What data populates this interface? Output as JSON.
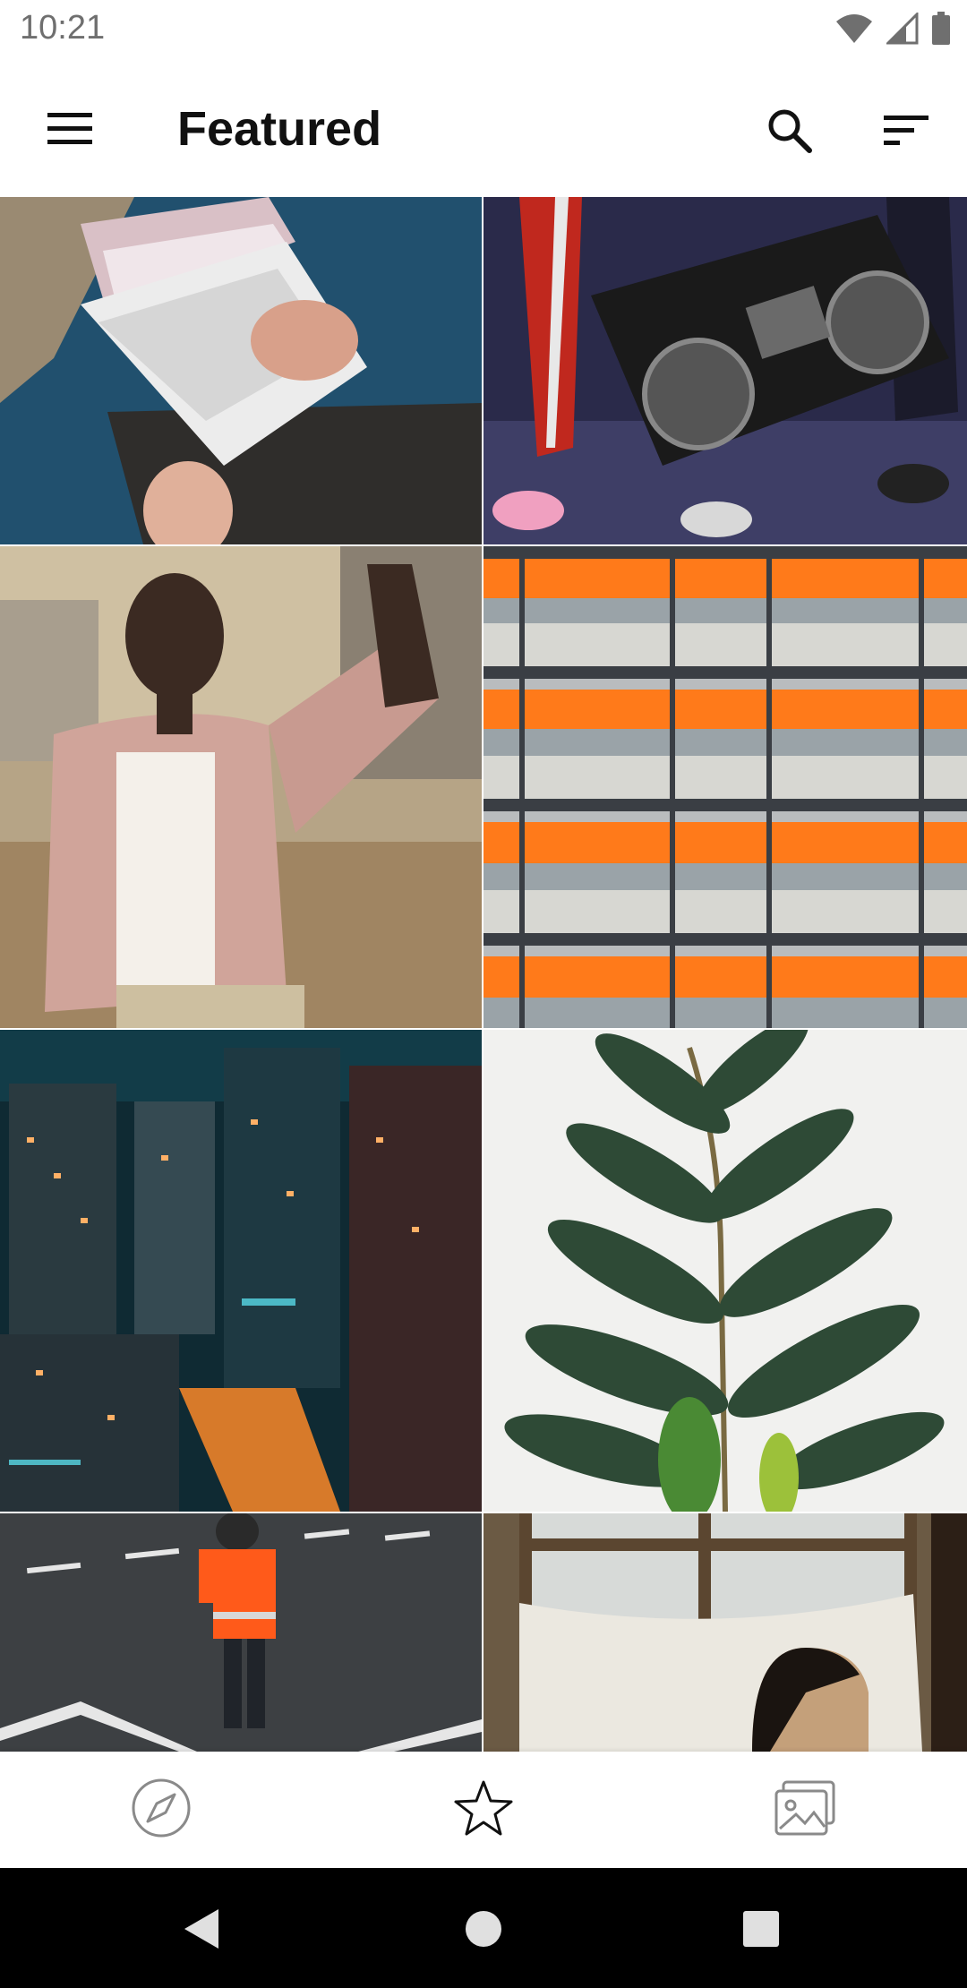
{
  "status_bar": {
    "time": "10:21",
    "icons": [
      "wifi-icon",
      "signal-icon",
      "battery-icon"
    ]
  },
  "app_bar": {
    "title": "Featured",
    "menu_icon": "menu-icon",
    "search_icon": "search-icon",
    "sort_icon": "sort-icon"
  },
  "photos": [
    {
      "subject": "laptop-on-lap"
    },
    {
      "subject": "boombox"
    },
    {
      "subject": "man-pink-jacket"
    },
    {
      "subject": "orange-balconies"
    },
    {
      "subject": "city-night"
    },
    {
      "subject": "green-plant"
    },
    {
      "subject": "traffic-worker"
    },
    {
      "subject": "window-curtain"
    }
  ],
  "bottom_nav": {
    "items": [
      {
        "icon": "compass-icon",
        "active": false
      },
      {
        "icon": "star-icon",
        "active": true
      },
      {
        "icon": "gallery-icon",
        "active": false
      }
    ]
  },
  "system_nav": [
    "back-icon",
    "home-icon",
    "recents-icon"
  ],
  "colors": {
    "accent": "#111111",
    "inactive_icon": "#8a8a8a",
    "system_bar": "#000000"
  }
}
